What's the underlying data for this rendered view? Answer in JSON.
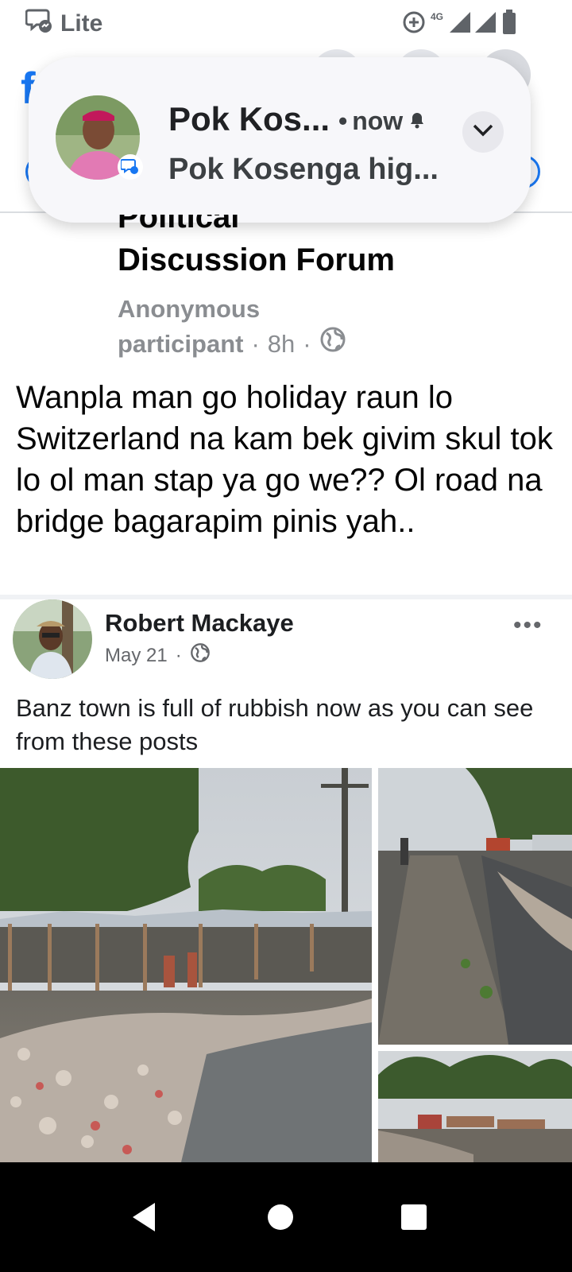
{
  "status_bar": {
    "app_name": "Lite",
    "network": "4G"
  },
  "notification": {
    "sender": "Pok Kos...",
    "separator": "•",
    "time": "now",
    "preview": "Pok Kosenga hig..."
  },
  "shared_post": {
    "group_name_line1": "Political",
    "group_name_line2": "Discussion Forum",
    "author_line1": "Anonymous",
    "author_line2": "participant",
    "dot": "·",
    "time": "8h",
    "text": "Wanpla man go holiday raun lo Switzerland na kam bek givim skul tok lo ol man stap ya go we?? Ol road na bridge bagarapim pinis yah.."
  },
  "embedded_post": {
    "author": "Robert Mackaye",
    "date": "May 21",
    "dot": "·",
    "more": "•••",
    "text": "Banz town is full of rubbish now as you can see from these posts"
  },
  "colors": {
    "facebook_blue": "#1877f2",
    "meta_gray": "#8a8d91",
    "nav_bar": "#000000"
  },
  "icons": [
    "messenger-lite-icon",
    "data-saver-icon",
    "signal-icon",
    "battery-icon",
    "bell-icon",
    "chevron-down-icon",
    "globe-icon",
    "more-icon",
    "back-icon",
    "home-icon",
    "recents-icon"
  ]
}
